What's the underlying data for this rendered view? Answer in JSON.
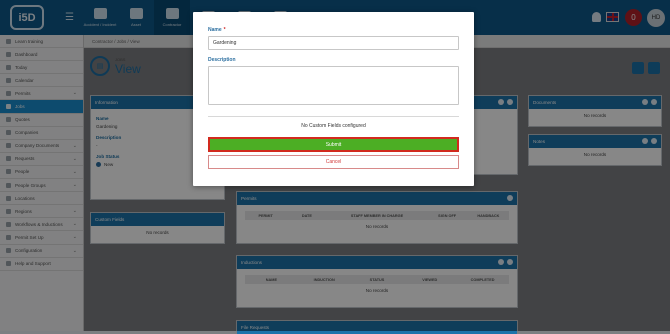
{
  "topbar": {
    "logo_text": "i5D",
    "nav": [
      {
        "label": "Accident / Incident"
      },
      {
        "label": "Asset"
      },
      {
        "label": "Contractor"
      },
      {
        "label": ""
      },
      {
        "label": ""
      },
      {
        "label": ""
      }
    ],
    "notif_count": "0",
    "user_initials": "HD"
  },
  "sidebar": {
    "items": [
      {
        "label": "Learn training",
        "icon": "graduation-icon"
      },
      {
        "label": "Dashboard",
        "icon": "dashboard-icon"
      },
      {
        "label": "Today",
        "icon": "today-icon"
      },
      {
        "label": "Calendar",
        "icon": "calendar-icon"
      },
      {
        "label": "Permits",
        "icon": "permit-icon",
        "chevron": "⌄"
      },
      {
        "label": "Jobs",
        "icon": "jobs-icon",
        "active": true
      },
      {
        "label": "Quotes",
        "icon": "quotes-icon"
      },
      {
        "label": "Companies",
        "icon": "companies-icon"
      },
      {
        "label": "Company Documents",
        "icon": "documents-icon",
        "chevron": "⌄"
      },
      {
        "label": "Requests",
        "icon": "requests-icon",
        "chevron": "⌄"
      },
      {
        "label": "People",
        "icon": "people-icon",
        "chevron": "⌄"
      },
      {
        "label": "People Groups",
        "icon": "people-groups-icon",
        "chevron": "⌄"
      },
      {
        "label": "Locations",
        "icon": "locations-icon"
      },
      {
        "label": "Regions",
        "icon": "regions-icon",
        "chevron": "⌄"
      },
      {
        "label": "Workflows & Inductions",
        "icon": "workflows-icon",
        "chevron": "⌄"
      },
      {
        "label": "Permit Set Up",
        "icon": "permit-setup-icon",
        "chevron": "⌄"
      },
      {
        "label": "Configuration",
        "icon": "configuration-icon",
        "chevron": "⌄"
      },
      {
        "label": "Help and Support",
        "icon": "help-icon"
      }
    ]
  },
  "breadcrumb": "Contractor  /  Jobs  /  View",
  "page": {
    "small_title": "JOBS",
    "title": "View"
  },
  "panels": {
    "information": {
      "header": "Information",
      "name_label": "Name",
      "name_value": "Gardening",
      "description_label": "Description",
      "description_value": "-",
      "status_label": "Job Status",
      "status_value": "New"
    },
    "custom_fields": {
      "header": "Custom Fields",
      "empty": "No records"
    },
    "documents": {
      "header": "Documents",
      "empty": "No records"
    },
    "notes": {
      "header": "Notes",
      "empty": "No records"
    },
    "permits": {
      "header": "Permits",
      "columns": [
        "PERMIT",
        "DATE",
        "STAFF MEMBER IN CHARGE",
        "SIGN OFF",
        "HANDBACK"
      ],
      "empty": "No records"
    },
    "inductions": {
      "header": "Inductions",
      "columns": [
        "NAME",
        "INDUCTION",
        "STATUS",
        "VIEWED",
        "COMPLETED"
      ],
      "empty": "No records"
    },
    "file_requests": {
      "header": "File Requests"
    }
  },
  "modal": {
    "name_label": "Name",
    "required_mark": "*",
    "name_value": "Gardening",
    "description_label": "Description",
    "description_value": "",
    "custom_fields_note": "No Custom Fields configured",
    "submit_label": "Submit",
    "cancel_label": "Cancel"
  },
  "colors": {
    "topbar": "#0f5a8a",
    "accent": "#1d74ab",
    "submit": "#4cae24",
    "highlight_border": "#d22a1e",
    "cancel_text": "#d23b3b"
  }
}
